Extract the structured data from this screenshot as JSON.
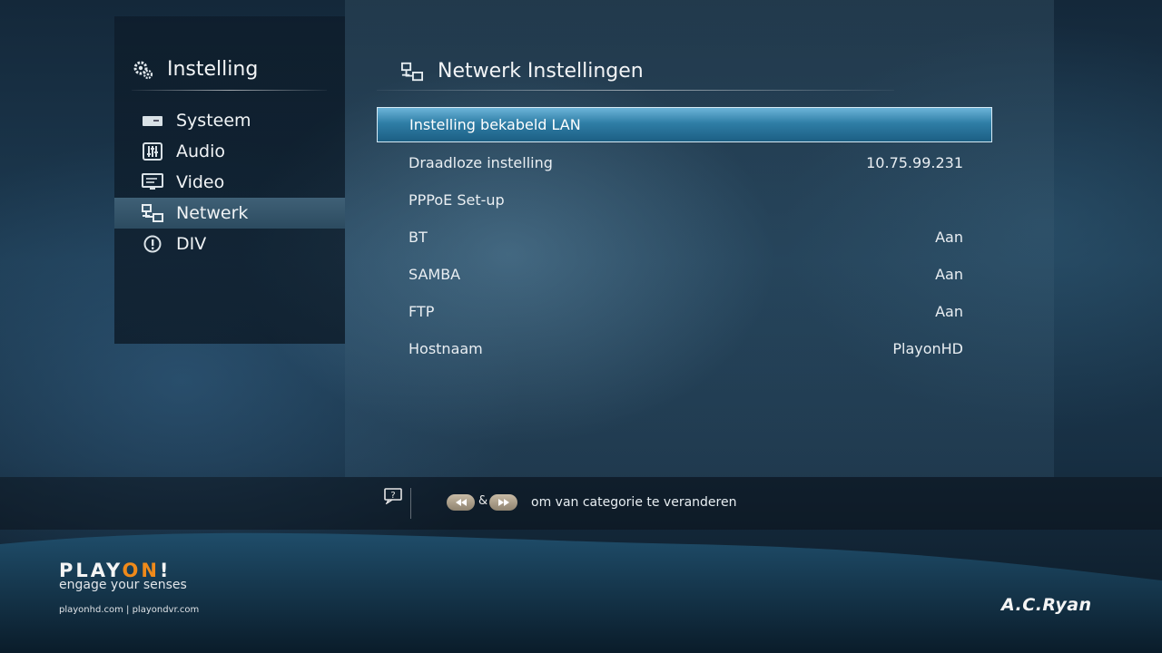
{
  "sidebar": {
    "title": "Instelling",
    "items": [
      {
        "label": "Systeem",
        "icon": "system-icon"
      },
      {
        "label": "Audio",
        "icon": "audio-icon"
      },
      {
        "label": "Video",
        "icon": "video-icon"
      },
      {
        "label": "Netwerk",
        "icon": "network-icon",
        "active": true
      },
      {
        "label": "DIV",
        "icon": "info-icon"
      }
    ]
  },
  "main": {
    "title": "Netwerk Instellingen",
    "rows": [
      {
        "label": "Instelling bekabeld LAN",
        "value": "",
        "selected": true
      },
      {
        "label": "Draadloze instelling",
        "value": "10.75.99.231"
      },
      {
        "label": "PPPoE Set-up",
        "value": ""
      },
      {
        "label": "BT",
        "value": "Aan"
      },
      {
        "label": "SAMBA",
        "value": "Aan"
      },
      {
        "label": "FTP",
        "value": "Aan"
      },
      {
        "label": "Hostnaam",
        "value": "PlayonHD"
      }
    ]
  },
  "help": {
    "ampersand": "&",
    "text": "om van categorie te veranderen"
  },
  "branding": {
    "logo_prefix": "PLAY",
    "logo_on": "ON",
    "logo_suffix": "!",
    "tagline": "engage your senses",
    "urls": "playonhd.com  |  playondvr.com",
    "manufacturer": "A.C.Ryan"
  },
  "colors": {
    "selection": "#2f7ea6",
    "active_sidebar": "#3f6076",
    "logo_accent": "#f08a1a"
  }
}
